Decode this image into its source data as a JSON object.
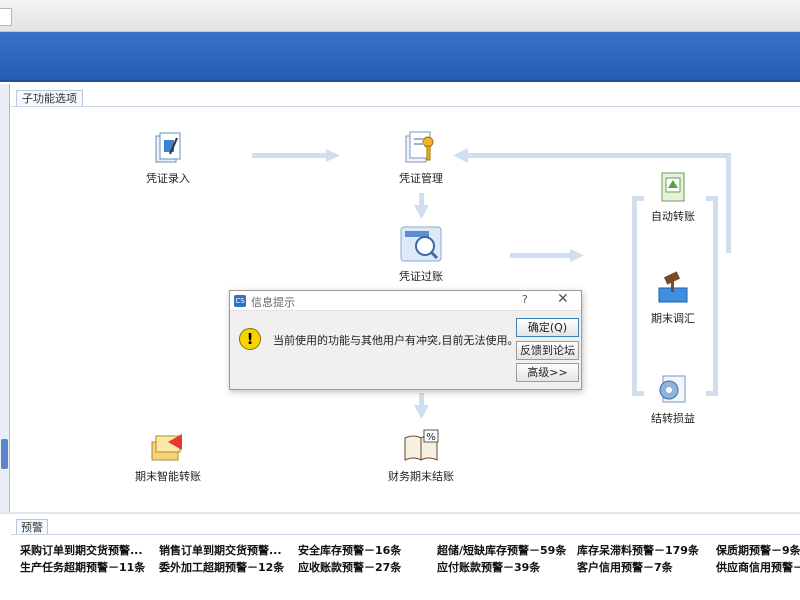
{
  "section": {
    "tab_label": "子功能选项"
  },
  "flow": {
    "voucher_entry": "凭证录入",
    "voucher_manage": "凭证管理",
    "voucher_post": "凭证过账",
    "auto_transfer": "自动转账",
    "period_adjust": "期末调汇",
    "transfer_pl": "结转损益",
    "smart_transfer": "期末智能转账",
    "period_close": "财务期末结账"
  },
  "dialog": {
    "title": "信息提示",
    "help": "?",
    "close": "✕",
    "icon_text": "!",
    "message": "当前使用的功能与其他用户有冲突,目前无法使用。",
    "btn_ok": "确定(Q)",
    "btn_feedback": "反馈到论坛",
    "btn_advanced": "高级>>"
  },
  "warnings": {
    "tab_label": "预警",
    "row1": [
      "采购订单到期交货预警...",
      "销售订单到期交货预警...",
      "安全库存预警－16条",
      "超储/短缺库存预警－59条",
      "库存呆滞料预警－179条",
      "保质期预警－9条"
    ],
    "row2": [
      "生产任务超期预警－11条",
      "委外加工超期预警－12条",
      "应收账款预警－27条",
      "应付账款预警－39条",
      "客户信用预警－7条",
      "供应商信用预警－"
    ]
  },
  "colors": {
    "banner": "#2f66bd",
    "arrow": "#cfdff0"
  }
}
